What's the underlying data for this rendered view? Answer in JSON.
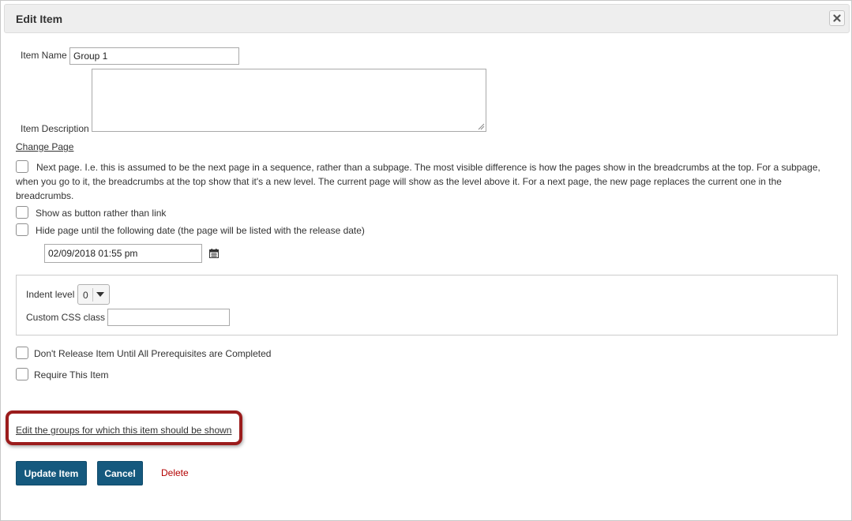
{
  "dialog": {
    "title": "Edit Item",
    "close_icon": "close-icon"
  },
  "form": {
    "item_name_label": "Item Name",
    "item_name_value": "Group 1",
    "item_description_label": "Item Description",
    "item_description_value": "",
    "change_page_link": "Change Page",
    "next_page_text": "Next page. I.e. this is assumed to be the next page in a sequence, rather than a subpage. The most visible difference is how the pages show in the breadcrumbs at the top. For a subpage, when you go to it, the breadcrumbs at the top show that it's a new level. The current page will show as the level above it. For a next page, the new page replaces the current one in the breadcrumbs.",
    "show_as_button_text": "Show as button rather than link",
    "hide_page_text": "Hide page until the following date (the page will be listed with the release date)",
    "release_date_value": "02/09/2018 01:55 pm",
    "calendar_icon": "calendar-icon",
    "indent_level_label": "Indent level",
    "indent_level_value": "0",
    "custom_css_label": "Custom CSS class",
    "custom_css_value": "",
    "prerequisites_text": "Don't Release Item Until All Prerequisites are Completed",
    "require_item_text": "Require This Item",
    "edit_groups_link": "Edit the groups for which this item should be shown"
  },
  "actions": {
    "update_label": "Update Item",
    "cancel_label": "Cancel",
    "delete_label": "Delete"
  },
  "colors": {
    "primary_button": "#15597e",
    "delete_link": "#b30000",
    "highlight_border": "#9b1c1c"
  }
}
